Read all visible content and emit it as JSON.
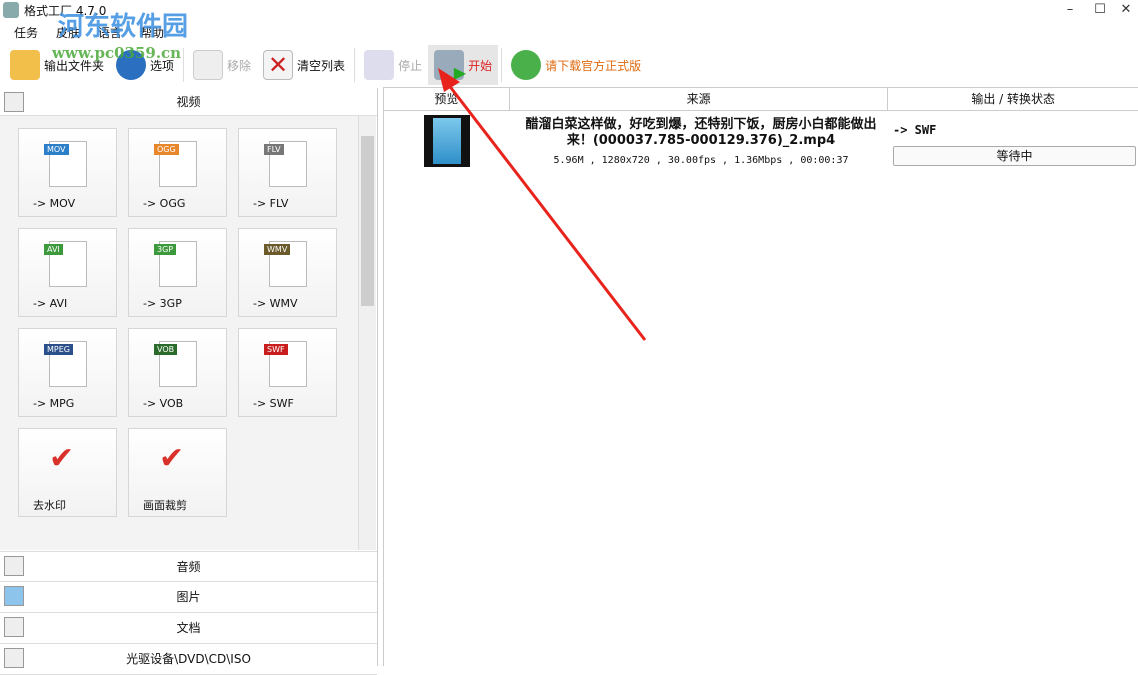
{
  "window": {
    "title": "格式工厂 4.7.0",
    "minimize": "–",
    "maximize": "☐",
    "close": "✕"
  },
  "menu": [
    "任务",
    "皮肤",
    "语言",
    "帮助"
  ],
  "watermark": {
    "name": "河东软件园",
    "url": "www.pc0359.cn"
  },
  "toolbar": {
    "output_folder": "输出文件夹",
    "options": "选项",
    "remove": "移除",
    "clear_list": "清空列表",
    "stop": "停止",
    "start": "开始",
    "download": "请下载官方正式版"
  },
  "left": {
    "video_header": "视频",
    "tiles": [
      {
        "label": "-> MOV",
        "badge": "MOV",
        "color": "#2a7fc8"
      },
      {
        "label": "-> OGG",
        "badge": "OGG",
        "color": "#e8862a"
      },
      {
        "label": "-> FLV",
        "badge": "FLV",
        "color": "#777777"
      },
      {
        "label": "-> AVI",
        "badge": "AVI",
        "color": "#3c9a3c"
      },
      {
        "label": "-> 3GP",
        "badge": "3GP",
        "color": "#3c9a3c"
      },
      {
        "label": "-> WMV",
        "badge": "WMV",
        "color": "#6b5a2a"
      },
      {
        "label": "-> MPG",
        "badge": "MPEG",
        "color": "#2a4f8a"
      },
      {
        "label": "-> VOB",
        "badge": "VOB",
        "color": "#2a6a2a"
      },
      {
        "label": "-> SWF",
        "badge": "SWF",
        "color": "#c81e1e"
      },
      {
        "label": "去水印",
        "badge": "",
        "color": "#d9322b"
      },
      {
        "label": "画面裁剪",
        "badge": "",
        "color": "#d9322b"
      }
    ],
    "sections": [
      "音频",
      "图片",
      "文档",
      "光驱设备\\DVD\\CD\\ISO"
    ]
  },
  "table": {
    "headers": [
      "预览",
      "来源",
      "输出 / 转换状态"
    ],
    "rows": [
      {
        "title": "醋溜白菜这样做，好吃到爆，还特别下饭，厨房小白都能做出来！(000037.785-000129.376)_2.mp4",
        "info": "5.96M , 1280x720 , 30.00fps , 1.36Mbps , 00:00:37",
        "output": "-> SWF",
        "status": "等待中"
      }
    ]
  }
}
